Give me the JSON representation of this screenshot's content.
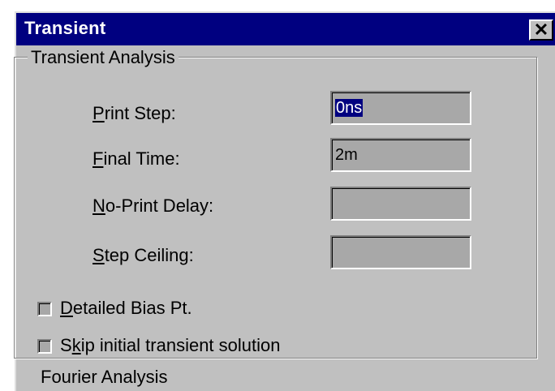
{
  "window": {
    "title": "Transient",
    "close_glyph": "✕"
  },
  "group": {
    "title": "Transient Analysis"
  },
  "fields": [
    {
      "label_mnemonic": "P",
      "label_rest": "rint Step:",
      "value": "0ns",
      "selected": true
    },
    {
      "label_mnemonic": "F",
      "label_rest": "inal Time:",
      "value": "2m",
      "selected": false
    },
    {
      "label_mnemonic": "N",
      "label_rest": "o-Print Delay:",
      "value": "",
      "selected": false
    },
    {
      "label_mnemonic": "S",
      "label_rest": "tep Ceiling:",
      "value": "",
      "selected": false
    }
  ],
  "checkboxes": [
    {
      "label_pre": "",
      "label_mnemonic": "D",
      "label_rest": "etailed Bias Pt.",
      "checked": false
    },
    {
      "label_pre": "S",
      "label_mnemonic": "k",
      "label_rest": "ip initial transient solution",
      "checked": false
    }
  ],
  "next_group": {
    "title": "Fourier Analysis"
  },
  "colors": {
    "titlebar": "#000080",
    "dialog_bg": "#c0c0c0",
    "field_bg": "#a8a8a8",
    "selection": "#000080"
  }
}
